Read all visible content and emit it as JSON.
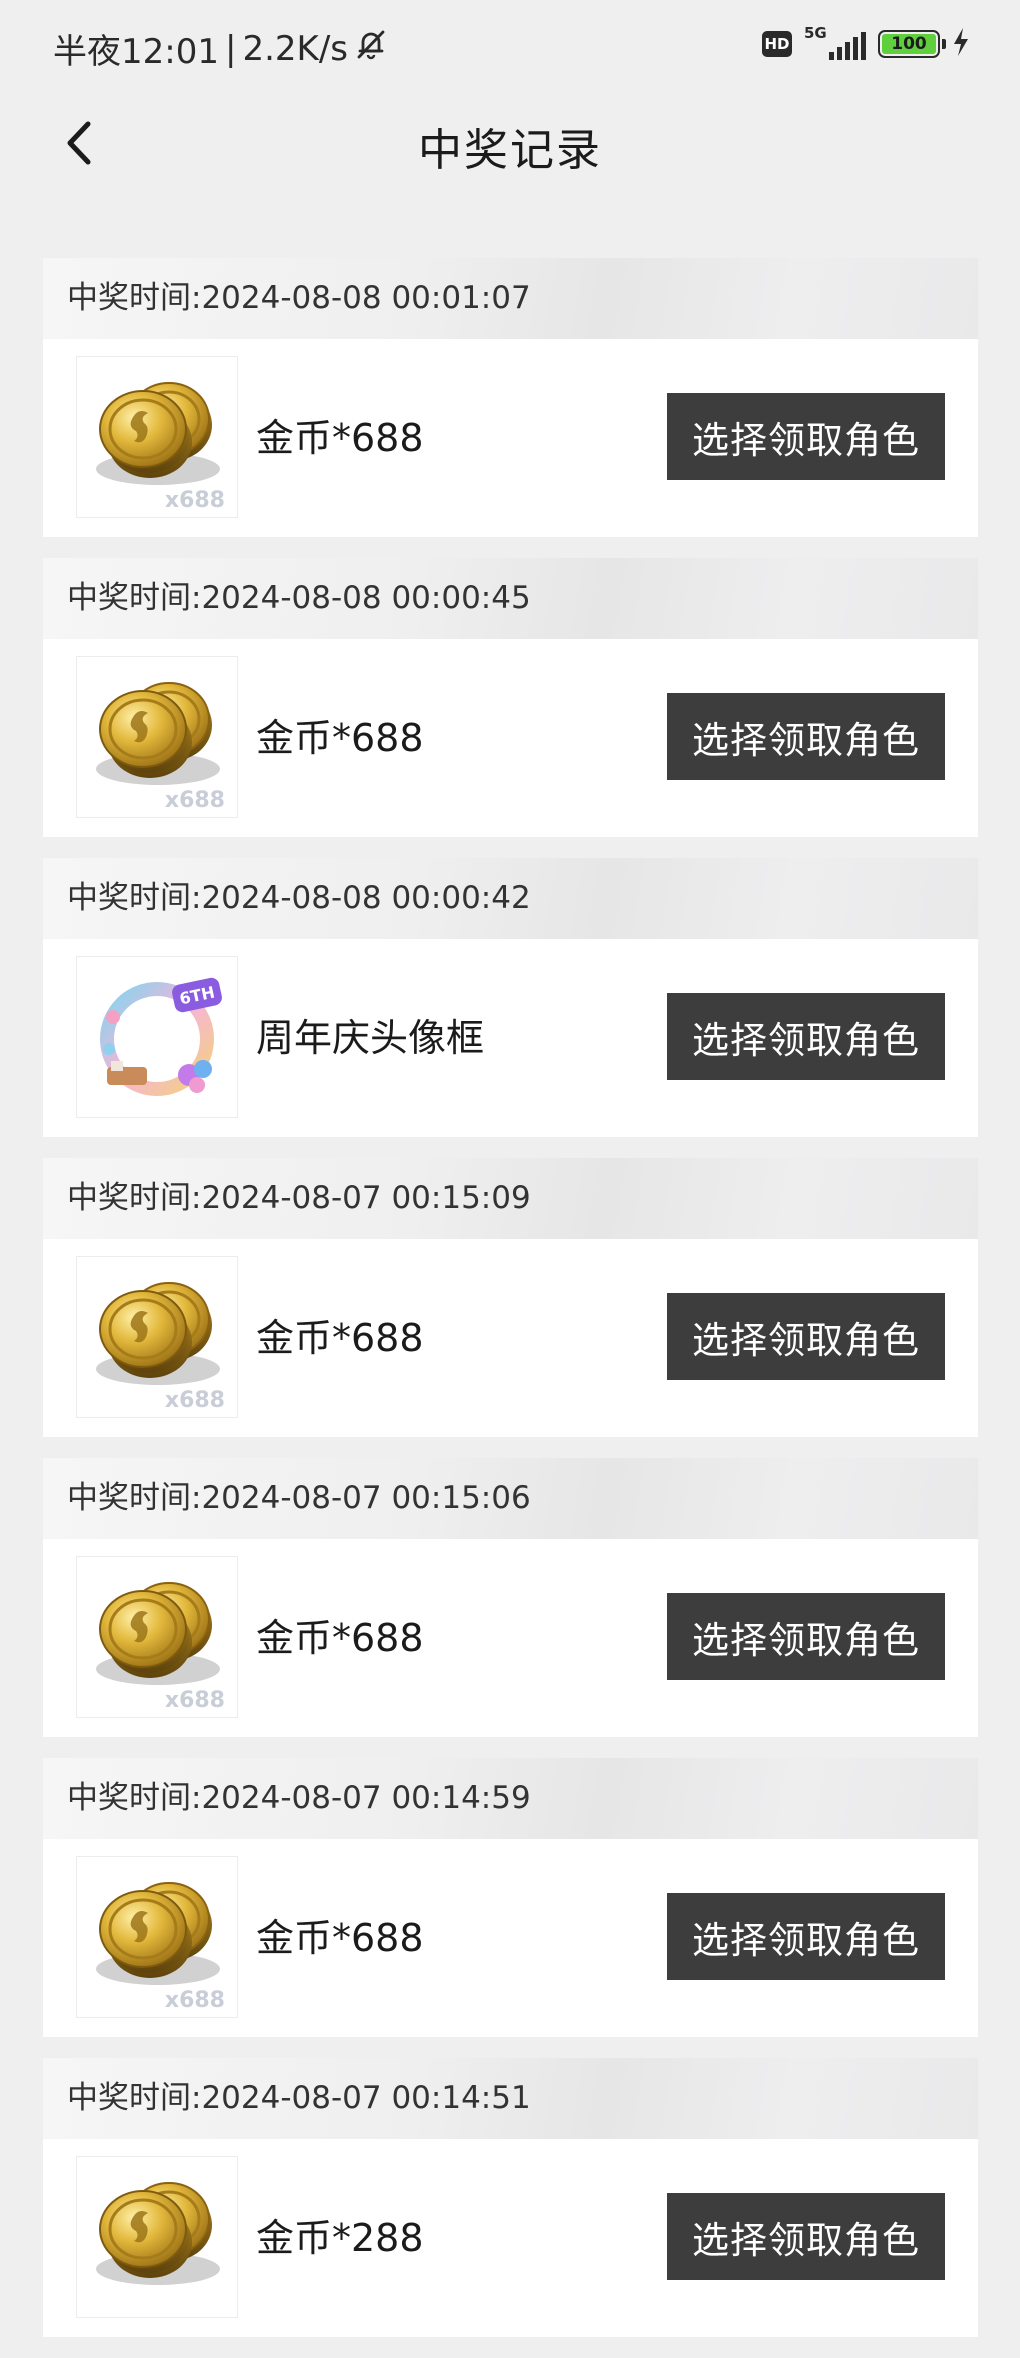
{
  "status_bar": {
    "time": "半夜12:01",
    "separator": "|",
    "network_speed": "2.2K/s",
    "hd_label": "HD",
    "network_type": "5G",
    "battery_level": "100"
  },
  "nav": {
    "title": "中奖记录"
  },
  "records": [
    {
      "time_label": "中奖时间:2024-08-08 00:01:07",
      "prize": "金币*688",
      "thumb": "coin-stack",
      "thumb_qty": "x688",
      "button": "选择领取角色"
    },
    {
      "time_label": "中奖时间:2024-08-08 00:00:45",
      "prize": "金币*688",
      "thumb": "coin-stack",
      "thumb_qty": "x688",
      "button": "选择领取角色"
    },
    {
      "time_label": "中奖时间:2024-08-08 00:00:42",
      "prize": "周年庆头像框",
      "thumb": "anniversary-avatar-frame",
      "thumb_badge": "6TH",
      "button": "选择领取角色"
    },
    {
      "time_label": "中奖时间:2024-08-07 00:15:09",
      "prize": "金币*688",
      "thumb": "coin-stack",
      "thumb_qty": "x688",
      "button": "选择领取角色"
    },
    {
      "time_label": "中奖时间:2024-08-07 00:15:06",
      "prize": "金币*688",
      "thumb": "coin-stack",
      "thumb_qty": "x688",
      "button": "选择领取角色"
    },
    {
      "time_label": "中奖时间:2024-08-07 00:14:59",
      "prize": "金币*688",
      "thumb": "coin-stack",
      "thumb_qty": "x688",
      "button": "选择领取角色"
    },
    {
      "time_label": "中奖时间:2024-08-07 00:14:51",
      "prize": "金币*288",
      "thumb": "coin-stack",
      "button": "选择领取角色"
    }
  ],
  "colors": {
    "page_bg": "#efeff0",
    "button_bg": "#3d3d3d",
    "button_text": "#ffffff",
    "coin_gold": "#d4a52a"
  }
}
